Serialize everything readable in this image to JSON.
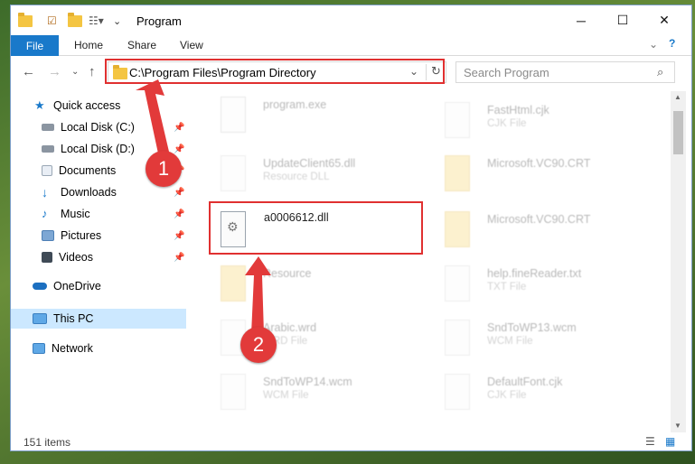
{
  "window": {
    "title": "Program"
  },
  "ribbon": {
    "file_tab": "File",
    "tabs": [
      "Home",
      "Share",
      "View"
    ]
  },
  "address": {
    "path": "C:\\Program Files\\Program Directory"
  },
  "search": {
    "placeholder": "Search Program"
  },
  "sidebar": {
    "items": [
      {
        "label": "Quick access",
        "icon": "star-icon"
      },
      {
        "label": "Local Disk (C:)",
        "icon": "drive-icon"
      },
      {
        "label": "Local Disk (D:)",
        "icon": "drive-icon"
      },
      {
        "label": "Documents",
        "icon": "documents-icon"
      },
      {
        "label": "Downloads",
        "icon": "download-icon"
      },
      {
        "label": "Music",
        "icon": "music-icon"
      },
      {
        "label": "Pictures",
        "icon": "pictures-icon"
      },
      {
        "label": "Videos",
        "icon": "videos-icon"
      },
      {
        "label": "OneDrive",
        "icon": "cloud-icon"
      },
      {
        "label": "This PC",
        "icon": "computer-icon"
      },
      {
        "label": "Network",
        "icon": "network-icon"
      }
    ]
  },
  "files": [
    {
      "name": "program.exe",
      "type": ""
    },
    {
      "name": "FastHtml.cjk",
      "type": "CJK File"
    },
    {
      "name": "UpdateClient65.dll",
      "type": "Resource DLL"
    },
    {
      "name": "Microsoft.VC90.CRT",
      "type": ""
    },
    {
      "name": "a0006612.dll",
      "type": ""
    },
    {
      "name": "Microsoft.VC90.CRT",
      "type": ""
    },
    {
      "name": "Resource",
      "type": ""
    },
    {
      "name": "help.fineReader.txt",
      "type": "TXT File"
    },
    {
      "name": "Arabic.wrd",
      "type": "WRD File"
    },
    {
      "name": "SndToWP13.wcm",
      "type": "WCM File"
    },
    {
      "name": "SndToWP14.wcm",
      "type": "WCM File"
    },
    {
      "name": "DefaultFont.cjk",
      "type": "CJK File"
    }
  ],
  "status": {
    "items_count": "151 items"
  },
  "annotations": {
    "step1": "1",
    "step2": "2"
  },
  "colors": {
    "accent": "#1979ca",
    "annotation_red": "#e03030"
  }
}
